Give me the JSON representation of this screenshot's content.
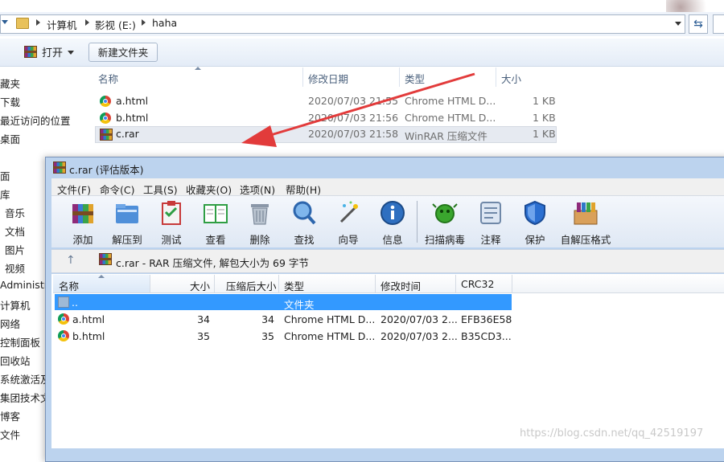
{
  "explorer": {
    "breadcrumb": [
      "计算机",
      "影视 (E:)",
      "haha"
    ],
    "toolbar": {
      "open_label": "打开",
      "new_folder_label": "新建文件夹"
    },
    "nav_items": [
      "藏夹",
      "下载",
      "最近访问的位置",
      "桌面",
      "面",
      "库",
      "音乐",
      "文档",
      "图片",
      "视频",
      "Administr",
      "计算机",
      "网络",
      "控制面板",
      "回收站",
      "系统激活及",
      "集团技术文",
      "博客",
      "文件"
    ],
    "columns": {
      "name": "名称",
      "modified": "修改日期",
      "type": "类型",
      "size": "大小"
    },
    "files": [
      {
        "icon": "chrome-icon",
        "name": "a.html",
        "modified": "2020/07/03 21:55",
        "type": "Chrome HTML D...",
        "size": "1 KB"
      },
      {
        "icon": "chrome-icon",
        "name": "b.html",
        "modified": "2020/07/03 21:56",
        "type": "Chrome HTML D...",
        "size": "1 KB"
      },
      {
        "icon": "winrar-icon",
        "name": "c.rar",
        "modified": "2020/07/03 21:58",
        "type": "WinRAR 压缩文件",
        "size": "1 KB"
      }
    ]
  },
  "winrar": {
    "title": "c.rar (评估版本)",
    "menu": [
      "文件(F)",
      "命令(C)",
      "工具(S)",
      "收藏夹(O)",
      "选项(N)",
      "帮助(H)"
    ],
    "tools": [
      {
        "icon": "add-icon",
        "label": "添加"
      },
      {
        "icon": "extract-to-icon",
        "label": "解压到"
      },
      {
        "icon": "test-icon",
        "label": "测试"
      },
      {
        "icon": "view-icon",
        "label": "查看"
      },
      {
        "icon": "delete-icon",
        "label": "删除"
      },
      {
        "icon": "find-icon",
        "label": "查找"
      },
      {
        "icon": "wizard-icon",
        "label": "向导"
      },
      {
        "icon": "info-icon",
        "label": "信息"
      },
      {
        "icon": "virus-scan-icon",
        "label": "扫描病毒"
      },
      {
        "icon": "comment-icon",
        "label": "注释"
      },
      {
        "icon": "protect-icon",
        "label": "保护"
      },
      {
        "icon": "sfx-icon",
        "label": "自解压格式"
      }
    ],
    "path_text": "c.rar - RAR 压缩文件, 解包大小为 69 字节",
    "columns": {
      "name": "名称",
      "size": "大小",
      "packed": "压缩后大小",
      "type": "类型",
      "modified": "修改时间",
      "crc": "CRC32"
    },
    "parent_row": {
      "name": "..",
      "type": "文件夹"
    },
    "files": [
      {
        "name": "a.html",
        "size": "34",
        "packed": "34",
        "type": "Chrome HTML D...",
        "modified": "2020/07/03 2...",
        "crc": "EFB36E58"
      },
      {
        "name": "b.html",
        "size": "35",
        "packed": "35",
        "type": "Chrome HTML D...",
        "modified": "2020/07/03 2...",
        "crc": "B35CD3..."
      }
    ]
  },
  "watermark": "https://blog.csdn.net/qq_42519197",
  "colors": {
    "selection": "#3399ff",
    "arrow": "#e23b3b",
    "explorer_bg": "#eef3fa",
    "rar_frame": "#bcd3ee"
  }
}
